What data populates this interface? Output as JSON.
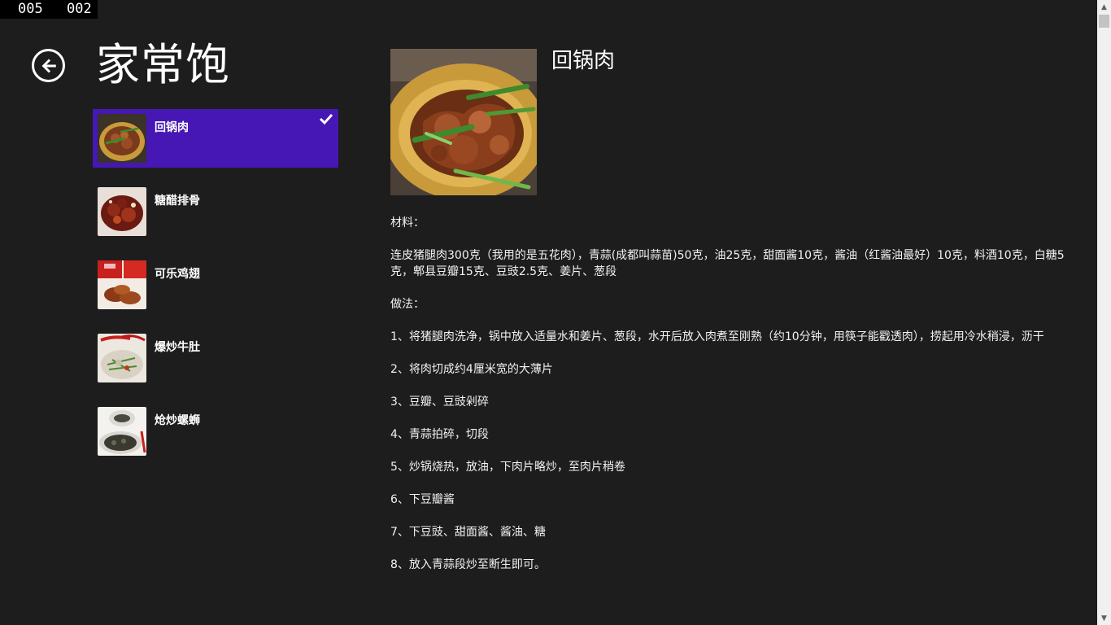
{
  "counter": {
    "left": "005",
    "right": "002"
  },
  "page": {
    "title": "家常饱"
  },
  "list": {
    "items": [
      {
        "label": "回锅肉",
        "selected": true
      },
      {
        "label": "糖醋排骨",
        "selected": false
      },
      {
        "label": "可乐鸡翅",
        "selected": false
      },
      {
        "label": "爆炒牛肚",
        "selected": false
      },
      {
        "label": "炝炒螺蛳",
        "selected": false
      }
    ]
  },
  "detail": {
    "title": "回锅肉",
    "ingredients_heading": "材料：",
    "ingredients": "连皮猪腿肉300克（我用的是五花肉），青蒜(成都叫蒜苗)50克，油25克，甜面酱10克，酱油（红酱油最好）10克，料酒10克，白糖5克，郫县豆瓣15克、豆豉2.5克、姜片、葱段",
    "method_heading": "做法：",
    "steps": [
      "1、将猪腿肉洗净，锅中放入适量水和姜片、葱段，水开后放入肉煮至刚熟（约10分钟，用筷子能戳透肉），捞起用冷水稍浸，沥干",
      "2、将肉切成约4厘米宽的大薄片",
      "3、豆瓣、豆豉剁碎",
      "4、青蒜拍碎，切段",
      "5、炒锅烧热，放油，下肉片略炒，至肉片稍卷",
      "6、下豆瓣酱",
      "7、下豆豉、甜面酱、酱油、糖",
      "8、放入青蒜段炒至断生即可。"
    ]
  },
  "colors": {
    "background": "#1d1d1d",
    "selected_item": "#4617b4",
    "text": "#ffffff"
  },
  "icons": {
    "back": "back-arrow-icon",
    "check": "checkmark-icon"
  }
}
